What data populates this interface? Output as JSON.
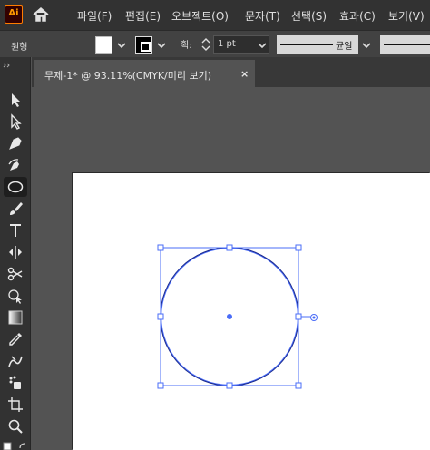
{
  "app": {
    "logo_text": "Ai",
    "brand_color": "#ff7c00"
  },
  "menu": {
    "items": [
      "파일(F)",
      "편집(E)",
      "오브젝트(O)",
      "문자(T)",
      "선택(S)",
      "효과(C)",
      "보기(V)"
    ]
  },
  "control_bar": {
    "object_label": "원형",
    "stroke_weight_label": "획:",
    "stroke_weight_value": "1 pt",
    "stroke_profile_label": "균일"
  },
  "document_tab": {
    "title": "무제-1* @ 93.11%(CMYK/미리 보기)",
    "close_glyph": "×"
  },
  "toolbar": {
    "tools": [
      "selection-tool",
      "direct-selection-tool",
      "pen-tool",
      "curvature-tool",
      "ellipse-tool",
      "paintbrush-tool",
      "type-tool",
      "width-tool",
      "scissors-tool",
      "shape-builder-tool",
      "gradient-tool",
      "eyedropper-tool",
      "blend-tool",
      "symbol-sprayer-tool",
      "artboard-tool",
      "zoom-tool"
    ],
    "active_tool": "ellipse-tool"
  },
  "colors": {
    "selection": "#4a6cf7",
    "ellipse_stroke": "#1b2a8a"
  }
}
